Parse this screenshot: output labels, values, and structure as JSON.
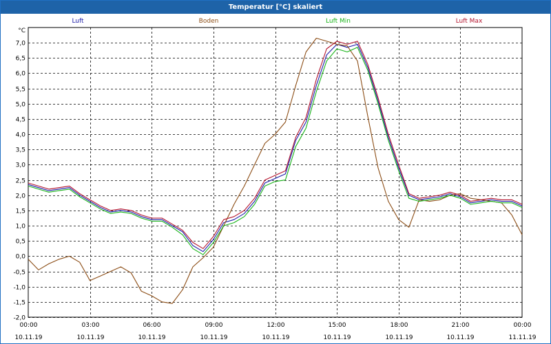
{
  "window": {
    "title": "Temperatur [°C] skaliert"
  },
  "chart_data": {
    "type": "line",
    "title": "Temperatur [°C] skaliert",
    "ylabel": "°C",
    "ylim": [
      -2.0,
      7.5
    ],
    "y_ticks": [
      "-2,0",
      "-1,5",
      "-1,0",
      "-0,5",
      "0,0",
      "0,5",
      "1,0",
      "1,5",
      "2,0",
      "2,5",
      "3,0",
      "3,5",
      "4,0",
      "4,5",
      "5,0",
      "5,5",
      "6,0",
      "6,5",
      "7,0"
    ],
    "y_tick_values": [
      -2.0,
      -1.5,
      -1.0,
      -0.5,
      0.0,
      0.5,
      1.0,
      1.5,
      2.0,
      2.5,
      3.0,
      3.5,
      4.0,
      4.5,
      5.0,
      5.5,
      6.0,
      6.5,
      7.0
    ],
    "x_range_hours": [
      0,
      24
    ],
    "x_ticks": [
      {
        "time": "00:00",
        "date": "10.11.19"
      },
      {
        "time": "03:00",
        "date": "10.11.19"
      },
      {
        "time": "06:00",
        "date": "10.11.19"
      },
      {
        "time": "09:00",
        "date": "10.11.19"
      },
      {
        "time": "12:00",
        "date": "10.11.19"
      },
      {
        "time": "15:00",
        "date": "10.11.19"
      },
      {
        "time": "18:00",
        "date": "10.11.19"
      },
      {
        "time": "21:00",
        "date": "10.11.19"
      },
      {
        "time": "00:00",
        "date": "11.11.19"
      }
    ],
    "grid": true,
    "legend": [
      {
        "name": "Luft",
        "color": "#1a1aa8"
      },
      {
        "name": "Boden",
        "color": "#8b4c14"
      },
      {
        "name": "Luft Min",
        "color": "#17b317"
      },
      {
        "name": "Luft Max",
        "color": "#b3122c"
      }
    ],
    "series": [
      {
        "name": "Luft",
        "color": "#1a1aa8",
        "x": [
          0,
          0.5,
          1,
          1.5,
          2,
          2.5,
          3,
          3.5,
          4,
          4.5,
          5,
          5.5,
          6,
          6.5,
          7,
          7.5,
          8,
          8.5,
          9,
          9.5,
          10,
          10.5,
          11,
          11.5,
          12,
          12.5,
          13,
          13.5,
          14,
          14.5,
          15,
          15.5,
          16,
          16.5,
          17,
          17.5,
          18,
          18.5,
          19,
          19.5,
          20,
          20.5,
          21,
          21.5,
          22,
          22.5,
          23,
          23.5,
          24
        ],
        "y": [
          2.35,
          2.25,
          2.15,
          2.2,
          2.25,
          2.0,
          1.8,
          1.6,
          1.45,
          1.5,
          1.45,
          1.3,
          1.2,
          1.2,
          1.0,
          0.8,
          0.35,
          0.15,
          0.55,
          1.1,
          1.2,
          1.4,
          1.8,
          2.4,
          2.55,
          2.7,
          3.8,
          4.4,
          5.6,
          6.6,
          6.95,
          6.85,
          6.95,
          6.2,
          5.1,
          3.9,
          2.9,
          2.0,
          1.85,
          1.9,
          1.95,
          2.05,
          1.95,
          1.75,
          1.8,
          1.85,
          1.8,
          1.8,
          1.65
        ]
      },
      {
        "name": "Boden",
        "color": "#8b4c14",
        "x": [
          0,
          0.5,
          1,
          1.5,
          2,
          2.5,
          3,
          3.5,
          4,
          4.5,
          5,
          5.5,
          6,
          6.5,
          7,
          7.5,
          8,
          8.5,
          9,
          9.5,
          10,
          10.5,
          11,
          11.5,
          12,
          12.5,
          13,
          13.5,
          14,
          14.5,
          15,
          15.5,
          16,
          16.5,
          17,
          17.5,
          18,
          18.5,
          19,
          19.5,
          20,
          20.5,
          21,
          21.5,
          22,
          22.5,
          23,
          23.5,
          24
        ],
        "y": [
          -0.1,
          -0.45,
          -0.25,
          -0.1,
          0.0,
          -0.2,
          -0.8,
          -0.65,
          -0.5,
          -0.35,
          -0.55,
          -1.15,
          -1.3,
          -1.5,
          -1.55,
          -1.1,
          -0.35,
          -0.05,
          0.3,
          1.0,
          1.7,
          2.3,
          3.0,
          3.7,
          4.0,
          4.4,
          5.6,
          6.7,
          7.15,
          7.05,
          6.95,
          6.9,
          6.4,
          4.6,
          2.9,
          1.8,
          1.2,
          0.95,
          1.85,
          1.8,
          1.85,
          2.0,
          2.05,
          1.9,
          1.85,
          1.8,
          1.75,
          1.35,
          0.7
        ]
      },
      {
        "name": "Luft Min",
        "color": "#17b317",
        "x": [
          0,
          0.5,
          1,
          1.5,
          2,
          2.5,
          3,
          3.5,
          4,
          4.5,
          5,
          5.5,
          6,
          6.5,
          7,
          7.5,
          8,
          8.5,
          9,
          9.5,
          10,
          10.5,
          11,
          11.5,
          12,
          12.5,
          13,
          13.5,
          14,
          14.5,
          15,
          15.5,
          16,
          16.5,
          17,
          17.5,
          18,
          18.5,
          19,
          19.5,
          20,
          20.5,
          21,
          21.5,
          22,
          22.5,
          23,
          23.5,
          24
        ],
        "y": [
          2.3,
          2.2,
          2.1,
          2.15,
          2.2,
          1.95,
          1.75,
          1.55,
          1.4,
          1.45,
          1.4,
          1.25,
          1.15,
          1.15,
          0.95,
          0.7,
          0.25,
          0.05,
          0.45,
          1.0,
          1.1,
          1.3,
          1.7,
          2.3,
          2.45,
          2.5,
          3.6,
          4.2,
          5.4,
          6.4,
          6.8,
          6.7,
          6.85,
          6.1,
          5.0,
          3.8,
          2.8,
          1.9,
          1.8,
          1.85,
          1.9,
          2.0,
          1.9,
          1.7,
          1.75,
          1.8,
          1.75,
          1.75,
          1.6
        ]
      },
      {
        "name": "Luft Max",
        "color": "#b3122c",
        "x": [
          0,
          0.5,
          1,
          1.5,
          2,
          2.5,
          3,
          3.5,
          4,
          4.5,
          5,
          5.5,
          6,
          6.5,
          7,
          7.5,
          8,
          8.5,
          9,
          9.5,
          10,
          10.5,
          11,
          11.5,
          12,
          12.5,
          13,
          13.5,
          14,
          14.5,
          15,
          15.5,
          16,
          16.5,
          17,
          17.5,
          18,
          18.5,
          19,
          19.5,
          20,
          20.5,
          21,
          21.5,
          22,
          22.5,
          23,
          23.5,
          24
        ],
        "y": [
          2.4,
          2.3,
          2.2,
          2.25,
          2.3,
          2.05,
          1.85,
          1.65,
          1.5,
          1.55,
          1.5,
          1.35,
          1.25,
          1.25,
          1.05,
          0.85,
          0.45,
          0.25,
          0.65,
          1.2,
          1.3,
          1.5,
          1.9,
          2.5,
          2.65,
          2.8,
          3.9,
          4.55,
          5.8,
          6.8,
          7.05,
          6.95,
          7.05,
          6.3,
          5.2,
          4.0,
          3.0,
          2.05,
          1.9,
          1.95,
          2.0,
          2.1,
          2.0,
          1.8,
          1.85,
          1.9,
          1.85,
          1.85,
          1.7
        ]
      }
    ]
  }
}
